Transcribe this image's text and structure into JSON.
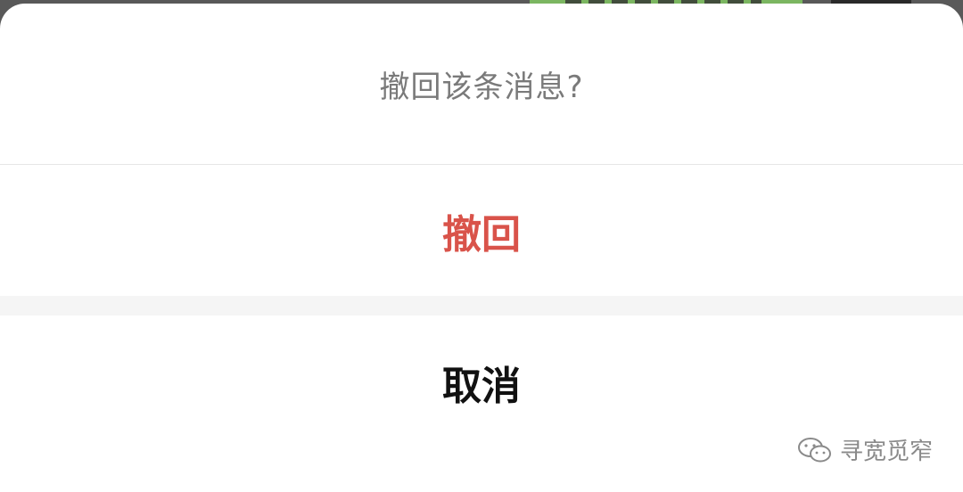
{
  "dialog": {
    "title": "撤回该条消息?",
    "recall_label": "撤回",
    "cancel_label": "取消"
  },
  "watermark": {
    "text": "寻宽觅窄",
    "icon": "wechat-icon"
  },
  "colors": {
    "recall": "#d9534a",
    "cancel": "#111111",
    "title": "#7a7a7a",
    "sheet_background": "#ffffff",
    "gap_background": "#f5f5f5"
  }
}
